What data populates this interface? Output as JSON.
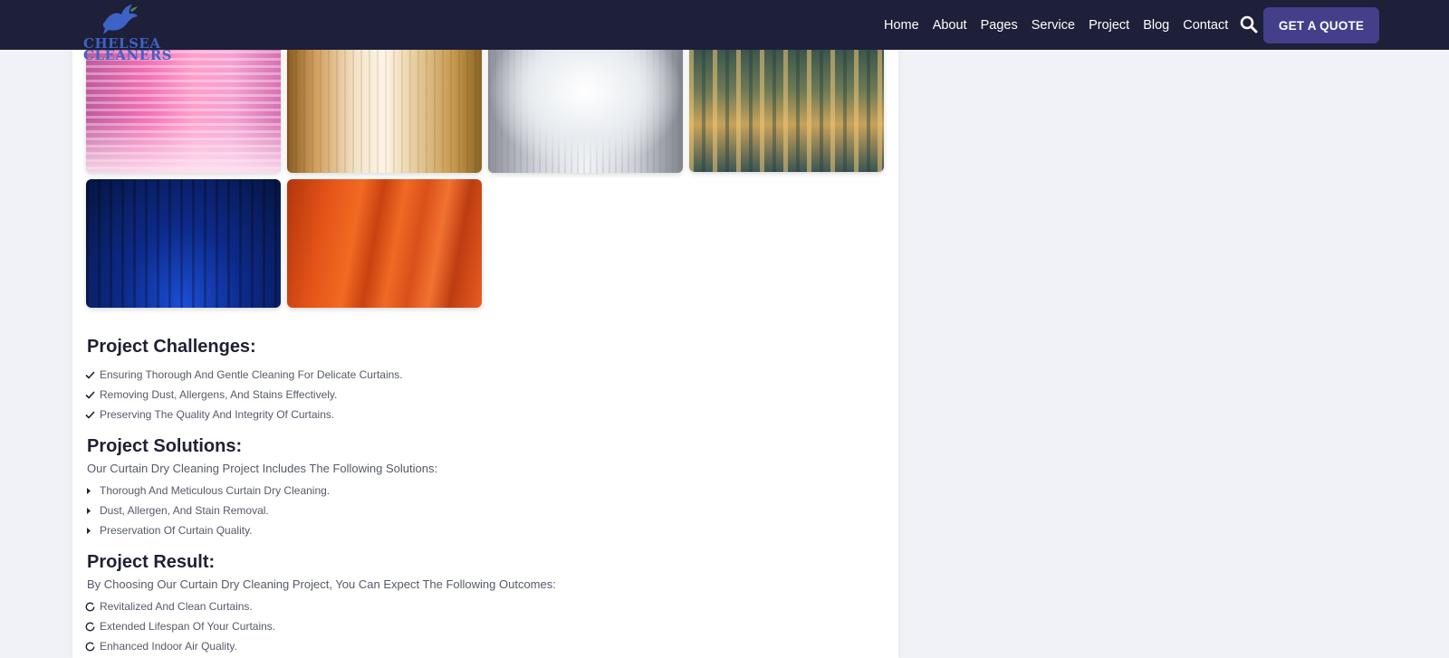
{
  "brand": {
    "logo_text_line1": "CHELSEA",
    "logo_text_line2": "CLEANERS",
    "logo_icon": "dove-icon",
    "primary_color": "#1e1f38",
    "accent_color": "#433f8a"
  },
  "nav": {
    "items": [
      {
        "label": "Home"
      },
      {
        "label": "About"
      },
      {
        "label": "Pages"
      },
      {
        "label": "Service"
      },
      {
        "label": "Project"
      },
      {
        "label": "Blog"
      },
      {
        "label": "Contact"
      }
    ],
    "search_icon": "search-icon",
    "cta_label": "GET A QUOTE"
  },
  "gallery": {
    "images": [
      {
        "name": "pink-window-blinds"
      },
      {
        "name": "beige-sheer-curtains"
      },
      {
        "name": "white-tied-curtains"
      },
      {
        "name": "golden-vertical-blinds"
      },
      {
        "name": "blue-velvet-curtain"
      },
      {
        "name": "orange-curtain"
      }
    ]
  },
  "challenges": {
    "title": "Project Challenges:",
    "icon": "check-icon",
    "items": [
      "Ensuring Thorough And Gentle Cleaning For Delicate Curtains.",
      "Removing Dust, Allergens, And Stains Effectively.",
      "Preserving The Quality And Integrity Of Curtains."
    ]
  },
  "solutions": {
    "title": "Project Solutions:",
    "intro": "Our Curtain Dry Cleaning Project Includes The Following Solutions:",
    "icon": "caret-right-icon",
    "items": [
      "Thorough And Meticulous Curtain Dry Cleaning.",
      "Dust, Allergen, And Stain Removal.",
      "Preservation Of Curtain Quality."
    ]
  },
  "result": {
    "title": "Project Result:",
    "intro": "By Choosing Our Curtain Dry Cleaning Project, You Can Expect The Following Outcomes:",
    "icon": "circle-icon",
    "items": [
      "Revitalized And Clean Curtains.",
      "Extended Lifespan Of Your Curtains.",
      "Enhanced Indoor Air Quality."
    ]
  }
}
